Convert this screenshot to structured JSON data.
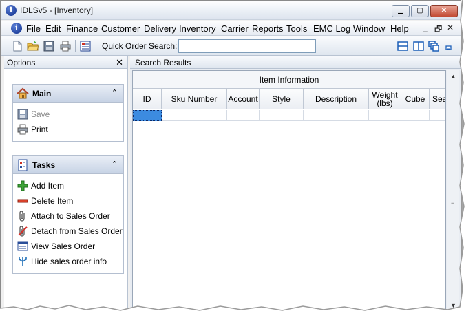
{
  "window": {
    "title": "IDLSv5 - [Inventory]",
    "app_icon_glyph": "i",
    "controls": {
      "minimize": "▁",
      "maximize": "▢",
      "close": "✕"
    }
  },
  "menu": {
    "items": [
      "File",
      "Edit",
      "Finance",
      "Customer",
      "Delivery",
      "Inventory",
      "Carrier",
      "Reports",
      "Tools",
      "EMC Log",
      "Window",
      "Help"
    ],
    "mdi_controls": {
      "minimize": "_",
      "restore": "🗗",
      "close": "✕"
    }
  },
  "toolbar": {
    "buttons": [
      "new-icon",
      "open-folder-icon",
      "save-icon",
      "print-icon",
      "report-icon"
    ],
    "quick_search_label": "Quick Order Search:",
    "quick_search_value": "",
    "layout_buttons": [
      "split-horizontal-icon",
      "split-vertical-icon",
      "cascade-icon",
      "minimize-all-icon"
    ]
  },
  "options": {
    "title": "Options",
    "close": "✕",
    "main_group": {
      "title": "Main",
      "items": [
        {
          "label": "Save",
          "icon": "save-icon",
          "enabled": false
        },
        {
          "label": "Print",
          "icon": "print-icon",
          "enabled": true
        }
      ]
    },
    "tasks_group": {
      "title": "Tasks",
      "items": [
        {
          "label": "Add Item",
          "icon": "add-icon"
        },
        {
          "label": "Delete Item",
          "icon": "delete-icon"
        },
        {
          "label": "Attach to Sales Order",
          "icon": "paperclip-icon"
        },
        {
          "label": "Detach from Sales Order",
          "icon": "detach-icon"
        },
        {
          "label": "View Sales Order",
          "icon": "view-list-icon"
        },
        {
          "label": "Hide sales order info",
          "icon": "hide-fork-icon"
        }
      ]
    },
    "collapse_glyph": "⌃"
  },
  "results": {
    "title": "Search Results",
    "group_header": "Item Information",
    "columns": [
      "ID",
      "Sku Number",
      "Account",
      "Style",
      "Description",
      "Weight\n(lbs)",
      "Cube",
      "Sea"
    ],
    "selection_color": "#3c8be0"
  }
}
